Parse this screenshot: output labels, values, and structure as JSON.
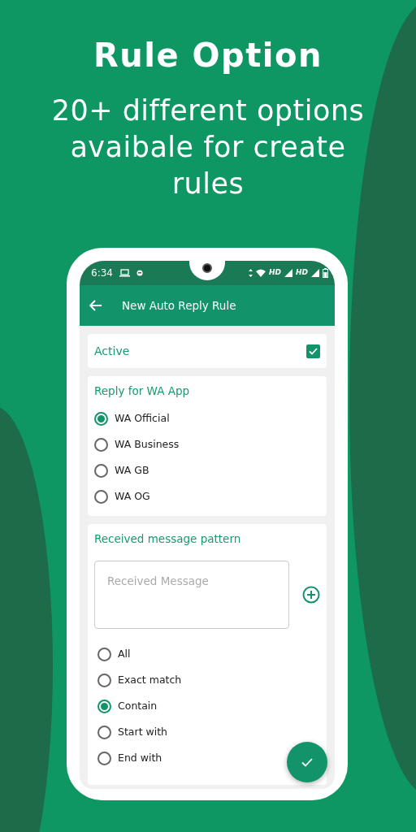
{
  "headline": "Rule Option",
  "subheadline": "20+ different options avaibale for create rules",
  "phone": {
    "status_bar": {
      "time": "6:34",
      "network_labels": [
        "HD",
        "HD"
      ]
    },
    "toolbar": {
      "title": "New Auto Reply Rule"
    },
    "active": {
      "label": "Active",
      "checked": true
    },
    "reply_for": {
      "title": "Reply for WA App",
      "options": [
        {
          "label": "WA Official",
          "selected": true
        },
        {
          "label": "WA Business",
          "selected": false
        },
        {
          "label": "WA GB",
          "selected": false
        },
        {
          "label": "WA OG",
          "selected": false
        }
      ]
    },
    "pattern": {
      "title": "Received message pattern",
      "message_field": {
        "placeholder": "Received Message"
      },
      "options": [
        {
          "label": "All",
          "selected": false
        },
        {
          "label": "Exact match",
          "selected": false
        },
        {
          "label": "Contain",
          "selected": true
        },
        {
          "label": "Start with",
          "selected": false
        },
        {
          "label": "End with",
          "selected": false
        }
      ]
    }
  }
}
